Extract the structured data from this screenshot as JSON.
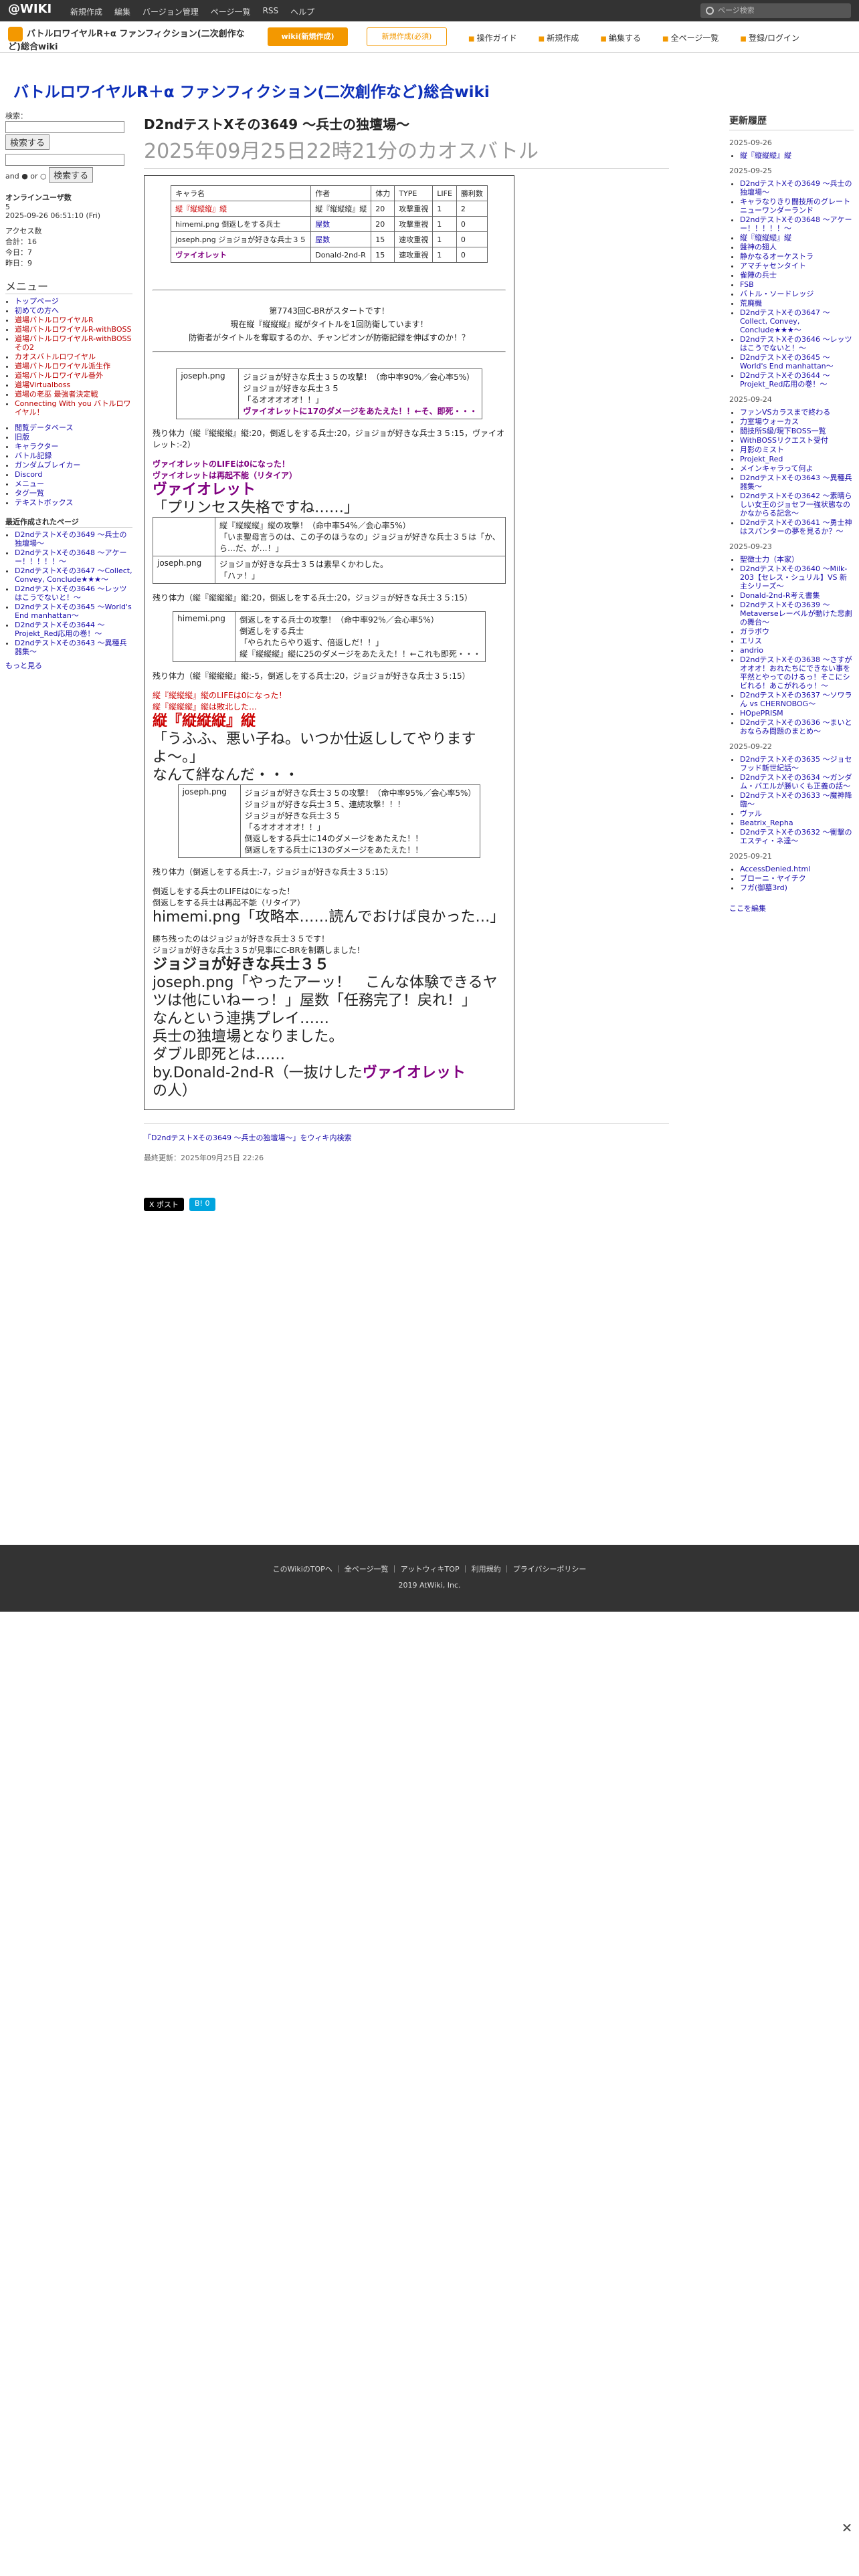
{
  "topbar": {
    "logo": "@WIKI",
    "menu": [
      "新規作成",
      "編集",
      "バージョン管理",
      "ページ一覧",
      "RSS",
      "ヘルプ"
    ],
    "search_placeholder": "ページ検索"
  },
  "wikibar": {
    "name": "バトルロワイヤルR+α ファンフィクション(二次創作など)総合wiki",
    "btn_primary": "wiki(新規作成)",
    "btn_secondary": "新規作成(必須)",
    "tools": [
      "操作ガイド",
      "新規作成",
      "編集する",
      "全ページ一覧",
      "登録/ログイン"
    ]
  },
  "site_title": "バトルロワイヤルR＋α ファンフィクション(二次創作など)総合wiki",
  "left": {
    "search_label": "検索：",
    "search_btn": "検索する",
    "and_or": "and ● or ○",
    "users_title": "オンラインユーザ数",
    "users_count": "5",
    "users_time": "2025-09-26 06:51:10 (Fri)",
    "access": [
      "アクセス数",
      "合計：16",
      "今日：7",
      "昨日：9"
    ],
    "menu_title": "メニュー",
    "menu_items": [
      "トップページ",
      "初めての方へ",
      "道場バトルロワイヤルR",
      "道場バトルロワイヤルR-withBOSS",
      "道場バトルロワイヤルR-withBOSSその2",
      "カオスバトルロワイヤル",
      "道場バトルロワイヤル派生作",
      "道場バトルロワイヤル番外",
      "道場Virtualboss",
      "道場の老巫 最強者決定戦",
      "Connecting With you バトルロワイヤル！"
    ],
    "sub_items": [
      "閲覧データベース",
      "旧版",
      "キャラクター",
      "バトル記録",
      "ガンダムブレイカー",
      "Discord",
      "メニュー",
      "タグ一覧",
      "テキストボックス"
    ],
    "recent_title": "最近作成されたページ",
    "recent": [
      "D2ndテストXその3649 〜兵士の独壇場〜",
      "D2ndテストXその3648 〜アケーー！！！！！〜",
      "D2ndテストXその3647 〜Collect, Convey, Conclude★★★〜",
      "D2ndテストXその3646 〜レッツはこうでないと！〜",
      "D2ndテストXその3645 〜World's End manhattan〜",
      "D2ndテストXその3644 〜Projekt_Red応用の巻！〜",
      "D2ndテストXその3643 〜異種兵器集〜"
    ],
    "more": "もっと見る"
  },
  "main": {
    "title": "D2ndテストXその3649 〜兵士の独壇場〜",
    "subtitle": "2025年09月25日22時21分のカオスバトル",
    "table_head": [
      "キャラ名",
      "作者",
      "体力",
      "TYPE",
      "LIFE",
      "勝利数"
    ],
    "table_rows": [
      [
        "縦『縦縦縦』縦",
        "縦『縦縦縦』縦",
        "20",
        "攻撃重視",
        "1",
        "2"
      ],
      [
        "himemi.png 倒返しをする兵士",
        "屋数",
        "20",
        "攻撃重視",
        "1",
        "0"
      ],
      [
        "joseph.png ジョジョが好きな兵士３５",
        "屋数",
        "15",
        "速攻重視",
        "1",
        "0"
      ],
      [
        "ヴァイオレット",
        "Donald-2nd-R",
        "15",
        "速攻重視",
        "1",
        "0"
      ]
    ],
    "intro1": "第7743回C-BRがスタートです！",
    "intro2": "現在縦『縦縦縦』縦がタイトルを1回防衛しています！",
    "intro3": "防衛者がタイトルを奪取するのか、チャンピオンが防衛記録を伸ばすのか！？",
    "b1": "ジョジョが好きな兵士３５の攻撃！（命中率90%／会心率5%）",
    "b2": "ジョジョが好きな兵士３５",
    "b3": "「るオオオオオ！！」",
    "b4": "ヴァイオレットに17のダメージをあたえた！！←そ、即死・・・",
    "hp1": "残り体力（縦『縦縦縦』縦:20，倒返しをする兵士:20，ジョジョが好きな兵士３５:15，ヴァイオレット:-2）",
    "lose1": "ヴァイオレットのLIFEは0になった！",
    "lose2": "ヴァイオレットは再起不能（リタイア）",
    "violet_big": "ヴァイオレット",
    "violet_quote": "「プリンセス失格ですね……」",
    "b5": "縦『縦縦縦』縦の攻撃！（命中率54%／会心率5%）",
    "b6": "「いま聖母言うのは、この子のほうなの」ジョジョが好きな兵士３５は「か、ら…だ、が…！」",
    "b7": "ジョジョが好きな兵士３５は素早くかわした。",
    "b8": "「ハァ！」",
    "hp2": "残り体力（縦『縦縦縦』縦:20，倒返しをする兵士:20，ジョジョが好きな兵士３５:15）",
    "b9": "倒返しをする兵士の攻撃！（命中率92%／会心率5%）",
    "b10": "倒返しをする兵士",
    "b11": "「やられたらやり返す、倍返しだ！！」",
    "b12": "縦『縦縦縦』縦に25のダメージをあたえた！！←これも即死・・・",
    "hp3": "残り体力（縦『縦縦縦』縦:-5，倒返しをする兵士:20，ジョジョが好きな兵士３５:15）",
    "lose3": "縦『縦縦縦』縦のLIFEは0になった！",
    "lose4": "縦『縦縦縦』縦は敗北した…",
    "kan_big": "縦『縦縦縦』縦",
    "kan_quote": "「うふふ、悪い子ね。いつか仕返ししてやりますよ〜。」",
    "kizuna": "なんて絆なんだ・・・",
    "b13": "ジョジョが好きな兵士３５の攻撃！（命中率95%／会心率5%）",
    "b14": "ジョジョが好きな兵士３５、連続攻撃！！！",
    "b15": "ジョジョが好きな兵士３５",
    "b16": "「るオオオオオ！！」",
    "b17": "倒返しをする兵士に14のダメージをあたえた！！",
    "b18": "倒返しをする兵士に13のダメージをあたえた！！",
    "hp4": "残り体力（倒返しをする兵士:-7，ジョジョが好きな兵士３５:15）",
    "lose5": "倒返しをする兵士のLIFEは0になった！",
    "lose6": "倒返しをする兵士は再起不能（リタイア）",
    "hime_quote": "himemi.png「攻略本……読んでおけば良かった…」",
    "win1": "勝ち残ったのはジョジョが好きな兵士３５です！",
    "win2": "ジョジョが好きな兵士３５が見事にC-BRを制覇しました！",
    "win_big": "ジョジョが好きな兵士３５",
    "win_quote": "joseph.png「やったアーッ！　こんな体験できるヤツは他にいねーっ！」屋数「任務完了！戻れ！」",
    "end1": "なんという連携プレイ……",
    "end2": "兵士の独壇場となりました。",
    "end3": "ダブル即死とは……",
    "end4_pre": "by.Donald-2nd-R（一抜けした",
    "end4_name": "ヴァイオレット",
    "end4_post": "の人）",
    "search_link": "「D2ndテストXその3649 〜兵士の独壇場〜」をウィキ内検索",
    "last_update": "最終更新：2025年09月25日 22:26",
    "share1": "X ポスト",
    "share2": "B! 0"
  },
  "right": {
    "title": "更新履歴",
    "groups": [
      {
        "date": "2025-09-26",
        "items": [
          "縦『縦縦縦』縦"
        ]
      },
      {
        "date": "2025-09-25",
        "items": [
          "D2ndテストXその3649 〜兵士の独壇場〜",
          "キャラなりきり闘技所のグレートニューワンダーランド",
          "D2ndテストXその3648 〜アケーー！！！！！〜",
          "縦『縦縦縦』縦",
          "盤神の翅人",
          "静かなるオーケストラ",
          "アマチャセンタイト",
          "雀陣の兵士",
          "FSB",
          "バトル・ソードレッジ",
          "荒廃機",
          "D2ndテストXその3647 〜Collect, Convey, Conclude★★★〜",
          "D2ndテストXその3646 〜レッツはこうでないと！〜",
          "D2ndテストXその3645 〜World's End manhattan〜",
          "D2ndテストXその3644 〜Projekt_Red応用の巻！〜"
        ]
      },
      {
        "date": "2025-09-24",
        "items": [
          "ファンVSカラスまで終わる",
          "力室場ウォーカス",
          "闘技所S級/現下BOSS一覧",
          "WithBOSSリクエスト受付",
          "月影のミスト",
          "Projekt_Red",
          "メインキャラって何よ",
          "D2ndテストXその3643 〜異種兵器集〜",
          "D2ndテストXその3642 〜素晴らしい女王のジョセフ一強状態なのかなからる記念〜",
          "D2ndテストXその3641 〜勇士神はスパンターの夢を見るか？〜"
        ]
      },
      {
        "date": "2025-09-23",
        "items": [
          "聖徴士力（本家）",
          "D2ndテストXその3640 〜Milk-203【セレス・シュリル】VS 新主シリーズ〜",
          "Donald-2nd-R考え書集",
          "D2ndテストXその3639 〜Metaverseレーベルが動けた悲劇の舞台〜",
          "ガラボウ",
          "エリス",
          "andrio",
          "D2ndテストXその3638 〜さすがオオオ！おれたちにできない事を平然とやってのけるっ！そこにシビれる！あこがれるゥ！〜",
          "D2ndテストXその3637 〜ソワラん vs CHERNOBOG〜",
          "HOpePRISM",
          "D2ndテストXその3636 〜まいとおならみ問題のまとめ〜"
        ]
      },
      {
        "date": "2025-09-22",
        "items": [
          "D2ndテストXその3635 〜ジョセフッド新世紀話〜",
          "D2ndテストXその3634 〜ガンダム・バエルが勝いくも正義の話〜",
          "D2ndテストXその3633 〜魔神降臨〜",
          "ヴァル",
          "Beatrix_Repha",
          "D2ndテストXその3632 〜衝撃のエスティ・ネ達〜"
        ]
      },
      {
        "date": "2025-09-21",
        "items": [
          "AccessDenied.html",
          "ブローニ・ヤイチク",
          "フガ(御墓3rd)"
        ]
      }
    ],
    "more": "ここを編集"
  },
  "footer": {
    "links": [
      "このWikiのTOPへ",
      "全ページ一覧",
      "アットウィキTOP",
      "利用規約",
      "プライバシーポリシー"
    ],
    "copy": "2019 AtWiki, Inc."
  }
}
